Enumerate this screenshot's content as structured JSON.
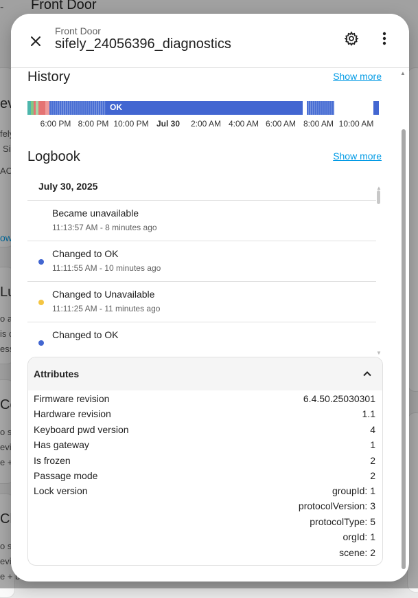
{
  "background": {
    "header_title": "Front Door",
    "back_arrow": "-",
    "fragments": [
      "ev",
      "fely",
      "Si",
      "AC",
      "ow",
      "Lu",
      "o a",
      "is c",
      "ess",
      "Ce",
      "o s",
      "evic",
      "e +",
      "Cl",
      "o s",
      "evic",
      "e + b"
    ]
  },
  "dialog": {
    "subtitle": "Front Door",
    "title": "sifely_24056396_diagnostics",
    "icons": {
      "close": "close-icon",
      "settings": "gear-icon",
      "more": "dots-vertical-icon"
    }
  },
  "history": {
    "title": "History",
    "show_more": "Show more",
    "state_label": "OK",
    "colors": {
      "ok": "#4266d1",
      "unavailable": "#f4c542",
      "problem": "#e57373",
      "teal": "#4db6ac"
    },
    "ticks": [
      "6:00 PM",
      "8:00 PM",
      "10:00 PM",
      "Jul 30",
      "2:00 AM",
      "4:00 AM",
      "6:00 AM",
      "8:00 AM",
      "10:00 AM"
    ]
  },
  "logbook": {
    "title": "Logbook",
    "show_more": "Show more",
    "date": "July 30, 2025",
    "entries": [
      {
        "message": "Became unavailable",
        "time": "11:13:57 AM - 8 minutes ago",
        "dot": ""
      },
      {
        "message": "Changed to OK",
        "time": "11:11:55 AM - 10 minutes ago",
        "dot": "#4266d1"
      },
      {
        "message": "Changed to Unavailable",
        "time": "11:11:25 AM - 11 minutes ago",
        "dot": "#f4c542"
      },
      {
        "message": "Changed to OK",
        "time": "",
        "dot": "#4266d1"
      }
    ]
  },
  "attributes": {
    "title": "Attributes",
    "rows": [
      {
        "name": "Firmware revision",
        "value": "6.4.50.25030301"
      },
      {
        "name": "Hardware revision",
        "value": "1.1"
      },
      {
        "name": "Keyboard pwd version",
        "value": "4"
      },
      {
        "name": "Has gateway",
        "value": "1"
      },
      {
        "name": "Is frozen",
        "value": "2"
      },
      {
        "name": "Passage mode",
        "value": "2"
      },
      {
        "name": "Lock version",
        "value": "groupId: 1"
      }
    ],
    "lock_version_extra": [
      "protocolVersion: 3",
      "protocolType: 5",
      "orgId: 1",
      "scene: 2"
    ]
  }
}
